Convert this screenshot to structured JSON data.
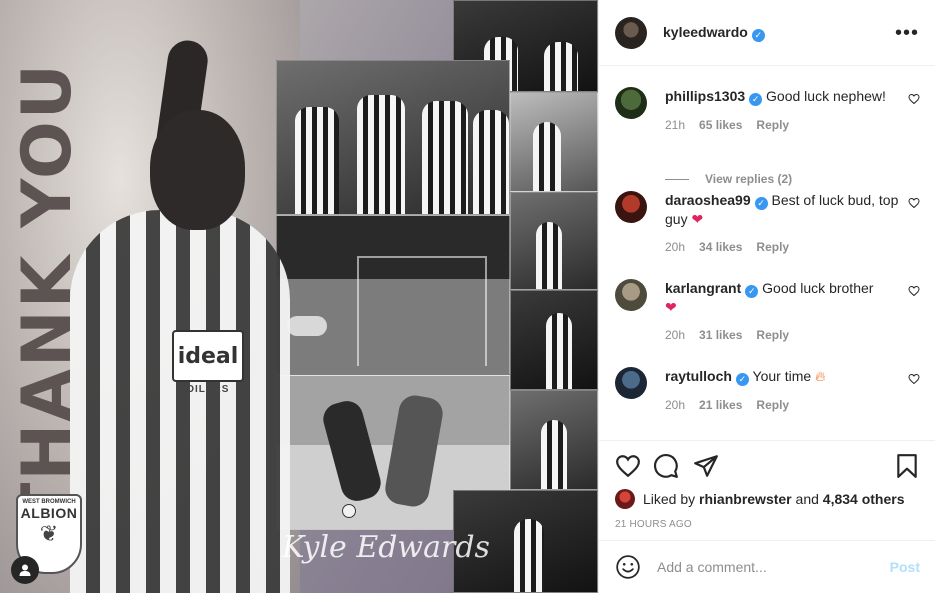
{
  "media": {
    "overlay_text": "THANK YOU",
    "signature": "Kyle Edwards",
    "sponsor": "ideal",
    "sponsor_sub": "BOILERS",
    "crest_top": "WEST BROMWICH",
    "crest_name": "ALBION"
  },
  "header": {
    "username": "kyleedwardo",
    "verified": true,
    "more_icon": "more-horizontal-icon"
  },
  "comments": [
    {
      "username": "phillips1303",
      "verified": true,
      "text": "Good luck nephew!",
      "time": "21h",
      "likes": "65 likes",
      "reply": "Reply",
      "view_replies": "View replies (2)"
    },
    {
      "username": "daraoshea99",
      "verified": true,
      "text": "Best of luck bud, top guy",
      "time": "20h",
      "likes": "34 likes",
      "reply": "Reply"
    },
    {
      "username": "karlangrant",
      "verified": true,
      "text": "Good luck brother",
      "time": "20h",
      "likes": "31 likes",
      "reply": "Reply"
    },
    {
      "username": "raytulloch",
      "verified": true,
      "text": "Your time",
      "time": "20h",
      "likes": "21 likes",
      "reply": "Reply"
    }
  ],
  "actions": {
    "liked_by_prefix": "Liked by",
    "liked_by_user": "rhianbrewster",
    "liked_by_and": "and",
    "liked_by_others": "4,834 others",
    "time_ago": "21 HOURS AGO"
  },
  "add_comment": {
    "placeholder": "Add a comment...",
    "post_label": "Post"
  },
  "colors": {
    "verified_blue": "#3897f0",
    "heart_red": "#ed4956",
    "post_disabled": "#b2dffc",
    "muted_text": "#8e8e8e"
  }
}
